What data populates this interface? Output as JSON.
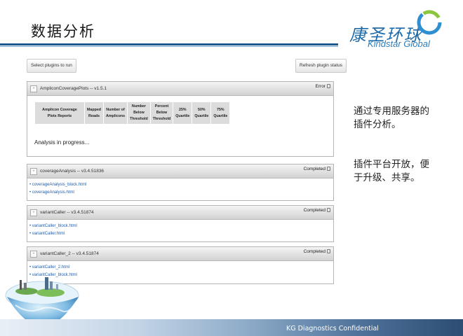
{
  "slide": {
    "title": "数据分析",
    "logo_cn": "康圣环球",
    "logo_en": "Kindstar Global",
    "footer": "KG Diagnostics Confidential",
    "notes": [
      "通过专用服务器的插件分析。",
      "插件平台开放，便于升级、共享。"
    ]
  },
  "toolbar": {
    "select_plugins": "Select plugins to run",
    "refresh_status": "Refresh plugin status"
  },
  "panels": [
    {
      "title": "AmpliconCoveragePlots -- v1.5.1",
      "status": "Error",
      "toggle": "-",
      "table_headers": [
        "Amplicon Coverage Plots Reports",
        "Mapped Reads",
        "Number of Amplicons",
        "Number Below Threshold",
        "Percent Below Threshold",
        "25% Quartile",
        "50% Quartile",
        "75% Quartile"
      ],
      "message": "Analysis in progress..."
    },
    {
      "title": "coverageAnalysis -- v3.4.51836",
      "status": "Completed",
      "toggle": "-",
      "links": [
        "coverageAnalysis_block.html",
        "coverageAnalysis.html"
      ]
    },
    {
      "title": "variantCaller -- v3.4.51874",
      "status": "Completed",
      "toggle": "-",
      "links": [
        "variantCaller_block.html",
        "variantCaller.html"
      ]
    },
    {
      "title": "variantCaller_2 -- v3.4.51874",
      "status": "Completed",
      "toggle": "-",
      "links": [
        "variantCaller_2.html",
        "variantCaller_block.html"
      ]
    }
  ],
  "colors": {
    "header_rule": "#1c5a8f",
    "link": "#1f5fb0",
    "brand_blue": "#1f6aa8"
  }
}
